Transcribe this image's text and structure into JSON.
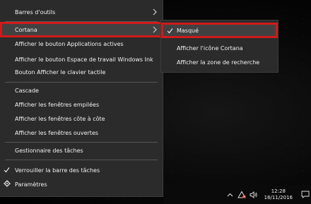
{
  "menu": {
    "items": [
      {
        "label": "Barres d'outils",
        "has_submenu": true
      },
      {
        "label": "Cortana",
        "has_submenu": true,
        "highlighted": true
      },
      {
        "label": "Afficher le bouton Applications actives"
      },
      {
        "label": "Afficher le bouton Espace de travail Windows Ink"
      },
      {
        "label": "Bouton Afficher le clavier tactile"
      },
      {
        "label": "Cascade"
      },
      {
        "label": "Afficher les fenêtres empilées"
      },
      {
        "label": "Afficher les fenêtres côte à côte"
      },
      {
        "label": "Afficher les fenêtres ouvertes"
      },
      {
        "label": "Gestionnaire des tâches"
      },
      {
        "label": "Verrouiller la barre des tâches",
        "checked": true
      },
      {
        "label": "Paramètres",
        "icon": "gear-icon"
      }
    ]
  },
  "submenu": {
    "items": [
      {
        "label": "Masqué",
        "checked": true,
        "highlighted": true
      },
      {
        "label": "Afficher l'icône Cortana"
      },
      {
        "label": "Afficher la zone de recherche"
      }
    ]
  },
  "taskbar": {
    "time": "12:28",
    "date": "16/11/2016",
    "tray_icons": [
      "chevron-up-icon",
      "network-icon",
      "volume-icon",
      "notification-icon"
    ]
  },
  "colors": {
    "menu_bg": "#2b2b2b",
    "highlight_bg": "#414141",
    "annotation_red": "#d01a1a",
    "text": "#f2f2f2"
  }
}
